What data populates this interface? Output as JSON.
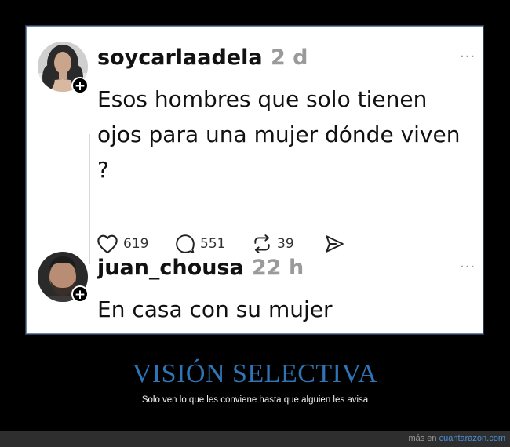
{
  "posts": [
    {
      "username": "soycarlaadela",
      "time": "2 d",
      "more": "···",
      "text": "Esos hombres que solo tienen ojos para una mujer dónde viven ?",
      "likes": "619",
      "comments": "551",
      "reposts": "39"
    },
    {
      "username": "juan_chousa",
      "time": "22 h",
      "more": "···",
      "text": "En casa con su mujer"
    }
  ],
  "caption": {
    "title": "VISIÓN SELECTIVA",
    "subtitle": "Solo ven lo que les conviene hasta que alguien les avisa"
  },
  "footer": {
    "prefix": "más en ",
    "link": "cuantarazon.com"
  },
  "colors": {
    "title": "#2f74b4",
    "link": "#4a90d6",
    "time": "#9a9a9a"
  }
}
